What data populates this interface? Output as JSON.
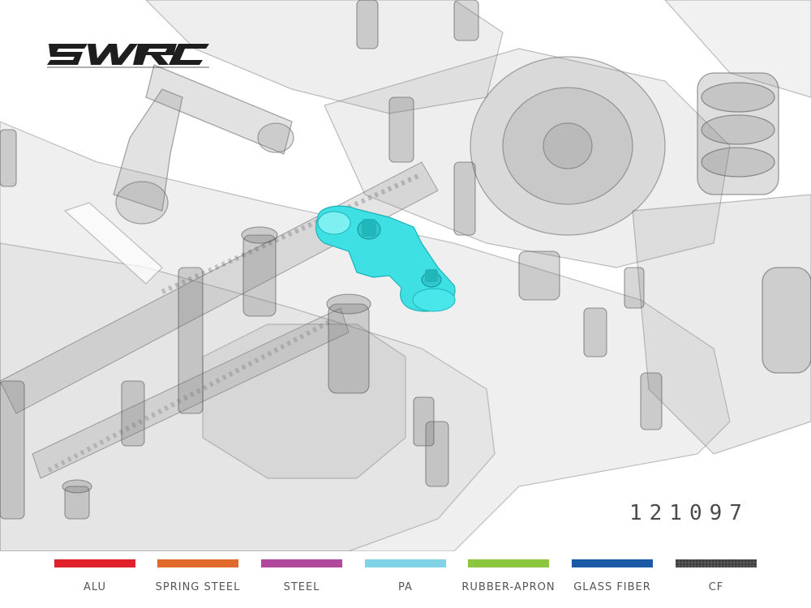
{
  "brand": {
    "logo_text": "SWRC",
    "logo_icon": "swrc-logo-icon"
  },
  "part_number": "121097",
  "highlighted_part": {
    "material": "PA",
    "color": "#3fe0e4"
  },
  "legend": [
    {
      "label": "ALU",
      "color": "#e0202a"
    },
    {
      "label": "SPRING STEEL",
      "color": "#e06a2a"
    },
    {
      "label": "STEEL",
      "color": "#b0489c"
    },
    {
      "label": "PA",
      "color": "#7fd3e4"
    },
    {
      "label": "RUBBER-APRON",
      "color": "#8cc63e"
    },
    {
      "label": "GLASS FIBER",
      "color": "#1a5aa6"
    },
    {
      "label": "CF",
      "color": "#3c3c3c",
      "pattern": "carbon-weave"
    }
  ]
}
